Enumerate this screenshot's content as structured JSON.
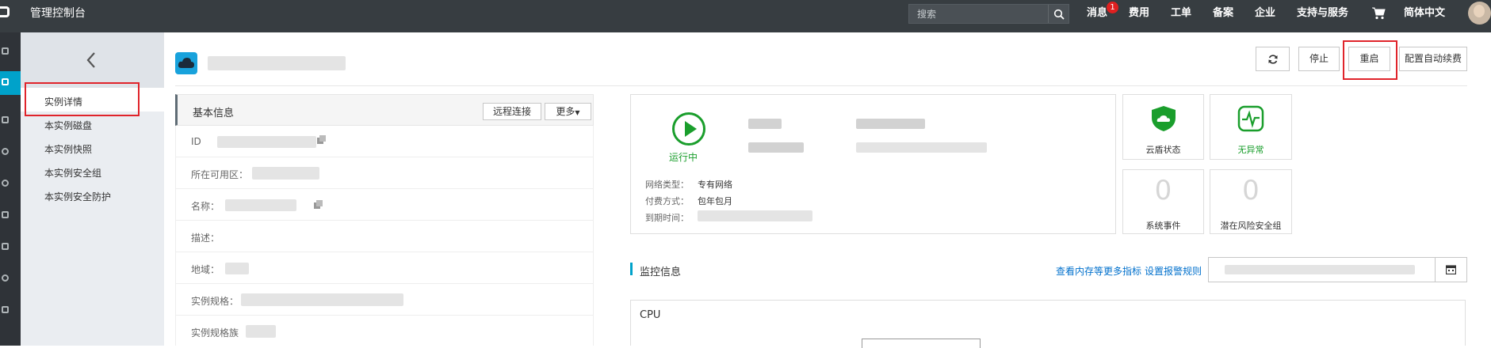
{
  "topbar": {
    "brand": "管理控制台",
    "search_placeholder": "搜索",
    "nav": [
      "消息",
      "费用",
      "工单",
      "备案",
      "企业",
      "支持与服务",
      "简体中文"
    ],
    "message_badge": "1"
  },
  "subnav": {
    "items": [
      {
        "label": "实例详情",
        "active": true
      },
      {
        "label": "本实例磁盘"
      },
      {
        "label": "本实例快照"
      },
      {
        "label": "本实例安全组"
      },
      {
        "label": "本实例安全防护"
      }
    ]
  },
  "header": {
    "buttons": {
      "stop": "停止",
      "restart": "重启",
      "renew": "配置自动续费"
    }
  },
  "basic_info": {
    "title": "基本信息",
    "remote_btn": "远程连接",
    "more_btn": "更多",
    "rows": [
      {
        "label": "ID"
      },
      {
        "label": "所在可用区："
      },
      {
        "label": "名称："
      },
      {
        "label": "描述："
      },
      {
        "label": "地域："
      },
      {
        "label": "实例规格："
      },
      {
        "label": "实例规格族"
      }
    ]
  },
  "status_card": {
    "status": "运行中",
    "network_label": "网络类型：",
    "network_value": "专有网络",
    "billing_label": "付费方式：",
    "billing_value": "包年包月",
    "expire_label": "到期时间："
  },
  "tiles": {
    "shield_label": "云盾状态",
    "health_label": "无异常",
    "events_count": "0",
    "events_label": "系统事件",
    "risk_count": "0",
    "risk_label": "潜在风险安全组"
  },
  "monitor": {
    "title": "监控信息",
    "link_metrics": "查看内存等更多指标",
    "link_alarm": "设置报警规则",
    "cpu_title": "CPU"
  },
  "colors": {
    "topbar": "#373d41",
    "accent": "#00a2ca",
    "running": "#1a9e2c",
    "link": "#0070cc",
    "highlight": "#e0242b"
  }
}
